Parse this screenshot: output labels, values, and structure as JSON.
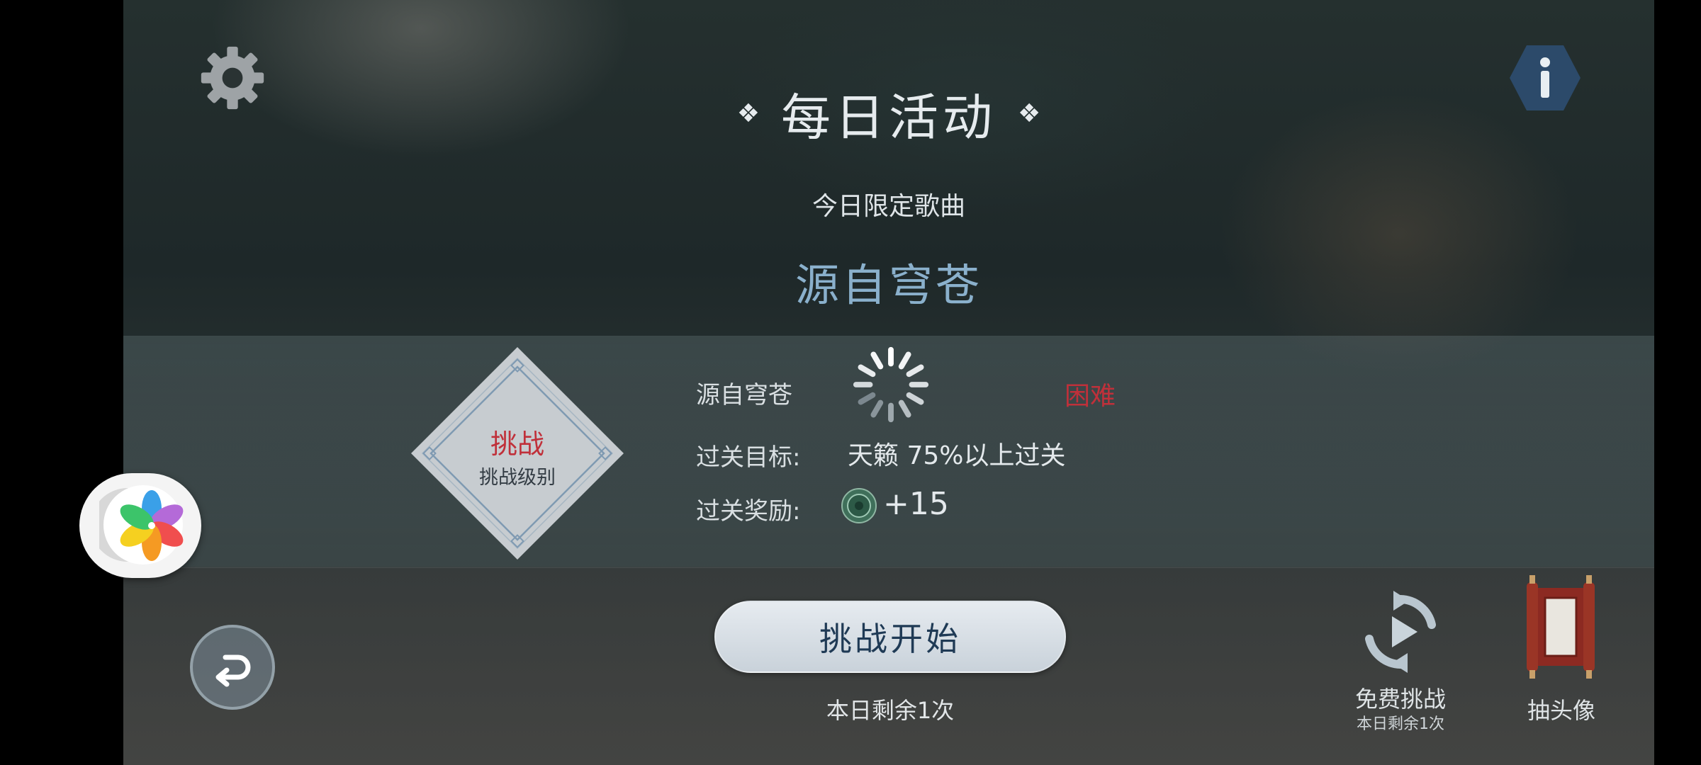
{
  "header": {
    "title": "每日活动",
    "title_deco_left": "❖",
    "title_deco_right": "❖",
    "subtitle": "今日限定歌曲",
    "song_name": "源自穹苍"
  },
  "challenge": {
    "badge_title": "挑战",
    "badge_subtitle": "挑战级别",
    "song_label": "源自穹苍",
    "difficulty": "困难",
    "goal_label": "过关目标:",
    "goal_value": "天籁 75%以上过关",
    "reward_label": "过关奖励:",
    "reward_value": "+15"
  },
  "actions": {
    "start_label": "挑战开始",
    "remaining": "本日剩余1次",
    "free_label": "免费挑战",
    "free_sub": "本日剩余1次",
    "avatar_label": "抽头像"
  },
  "icons": {
    "settings": "gear-icon",
    "info": "info-icon",
    "back": "back-arrow-icon",
    "loading": "spinner-icon",
    "reward": "jade-coin-icon",
    "free": "replay-icon",
    "avatar": "scroll-icon",
    "floating": "pinwheel-icon"
  },
  "colors": {
    "accent_red": "#c0303a",
    "song_blue": "#8ab0cc",
    "info_hex": "#2c4a6a",
    "start_text": "#1f3a55"
  }
}
